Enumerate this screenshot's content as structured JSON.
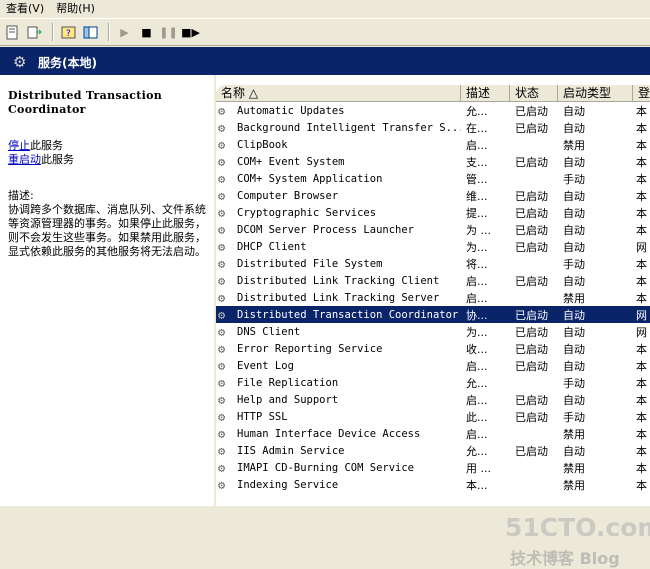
{
  "menu": {
    "view": "查看(V)",
    "help": "帮助(H)"
  },
  "title": "服务(本地)",
  "left": {
    "service_name": "Distributed Transaction Coordinator",
    "stop_link": "停止",
    "stop_suffix": "此服务",
    "restart_link": "重启动",
    "restart_suffix": "此服务",
    "desc_label": "描述:",
    "desc_text": "协调跨多个数据库、消息队列、文件系统等资源管理器的事务。如果停止此服务，则不会发生这些事务。如果禁用此服务，显式依赖此服务的其他服务将无法启动。"
  },
  "columns": {
    "name": "名称 △",
    "desc": "描述",
    "status": "状态",
    "startup": "启动类型",
    "logon": "登"
  },
  "services": [
    {
      "name": "Automatic Updates",
      "desc": "允...",
      "status": "已启动",
      "startup": "自动",
      "logon": "本"
    },
    {
      "name": "Background Intelligent Transfer S...",
      "desc": "在...",
      "status": "已启动",
      "startup": "自动",
      "logon": "本"
    },
    {
      "name": "ClipBook",
      "desc": "启...",
      "status": "",
      "startup": "禁用",
      "logon": "本"
    },
    {
      "name": "COM+ Event System",
      "desc": "支...",
      "status": "已启动",
      "startup": "自动",
      "logon": "本"
    },
    {
      "name": "COM+ System Application",
      "desc": "管...",
      "status": "",
      "startup": "手动",
      "logon": "本"
    },
    {
      "name": "Computer Browser",
      "desc": "维...",
      "status": "已启动",
      "startup": "自动",
      "logon": "本"
    },
    {
      "name": "Cryptographic Services",
      "desc": "提...",
      "status": "已启动",
      "startup": "自动",
      "logon": "本"
    },
    {
      "name": "DCOM Server Process Launcher",
      "desc": "为 ...",
      "status": "已启动",
      "startup": "自动",
      "logon": "本"
    },
    {
      "name": "DHCP Client",
      "desc": "为...",
      "status": "已启动",
      "startup": "自动",
      "logon": "网"
    },
    {
      "name": "Distributed File System",
      "desc": "将...",
      "status": "",
      "startup": "手动",
      "logon": "本"
    },
    {
      "name": "Distributed Link Tracking Client",
      "desc": "启...",
      "status": "已启动",
      "startup": "自动",
      "logon": "本"
    },
    {
      "name": "Distributed Link Tracking Server",
      "desc": "启...",
      "status": "",
      "startup": "禁用",
      "logon": "本"
    },
    {
      "name": "Distributed Transaction Coordinator",
      "desc": "协...",
      "status": "已启动",
      "startup": "自动",
      "logon": "网",
      "selected": true
    },
    {
      "name": "DNS Client",
      "desc": "为...",
      "status": "已启动",
      "startup": "自动",
      "logon": "网"
    },
    {
      "name": "Error Reporting Service",
      "desc": "收...",
      "status": "已启动",
      "startup": "自动",
      "logon": "本"
    },
    {
      "name": "Event Log",
      "desc": "启...",
      "status": "已启动",
      "startup": "自动",
      "logon": "本"
    },
    {
      "name": "File Replication",
      "desc": "允...",
      "status": "",
      "startup": "手动",
      "logon": "本"
    },
    {
      "name": "Help and Support",
      "desc": "启...",
      "status": "已启动",
      "startup": "自动",
      "logon": "本"
    },
    {
      "name": "HTTP SSL",
      "desc": "此...",
      "status": "已启动",
      "startup": "手动",
      "logon": "本"
    },
    {
      "name": "Human Interface Device Access",
      "desc": "启...",
      "status": "",
      "startup": "禁用",
      "logon": "本"
    },
    {
      "name": "IIS Admin Service",
      "desc": "允...",
      "status": "已启动",
      "startup": "自动",
      "logon": "本"
    },
    {
      "name": "IMAPI CD-Burning COM Service",
      "desc": "用 ...",
      "status": "",
      "startup": "禁用",
      "logon": "本"
    },
    {
      "name": "Indexing Service",
      "desc": "本...",
      "status": "",
      "startup": "禁用",
      "logon": "本"
    }
  ],
  "watermark": {
    "line1": "51CTO.com",
    "line2": "技术博客 Blog"
  }
}
